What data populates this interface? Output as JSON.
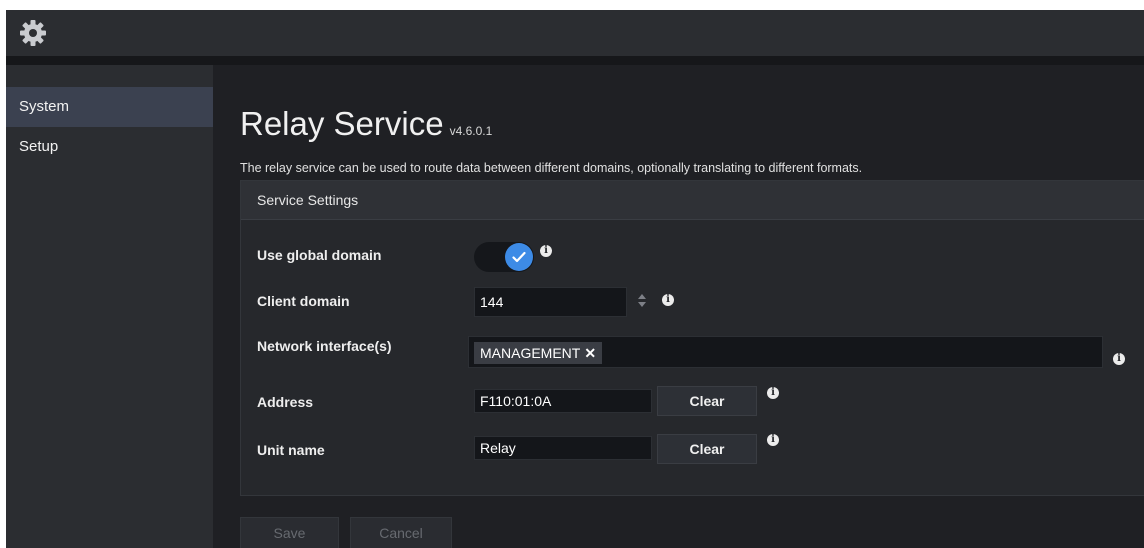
{
  "topbar": {
    "icon": "gear-icon"
  },
  "sidebar": {
    "items": [
      {
        "label": "System",
        "active": true
      },
      {
        "label": "Setup",
        "active": false
      }
    ]
  },
  "page": {
    "title": "Relay Service",
    "version": "v4.6.0.1",
    "description": "The relay service can be used to route data between different domains, optionally translating to different formats."
  },
  "panel": {
    "title": "Service Settings",
    "use_global_domain": {
      "label": "Use global domain",
      "checked": true,
      "info_icon": "info-icon"
    },
    "client_domain": {
      "label": "Client domain",
      "value": "144",
      "info_icon": "info-icon"
    },
    "network_interfaces": {
      "label": "Network interface(s)",
      "tags": [
        "MANAGEMENT"
      ],
      "remove_glyph": "✕",
      "info_icon": "info-icon"
    },
    "address": {
      "label": "Address",
      "value": "F110:01:0A",
      "clear_label": "Clear",
      "info_icon": "info-icon"
    },
    "unit_name": {
      "label": "Unit name",
      "value": "Relay",
      "clear_label": "Clear",
      "info_icon": "info-icon"
    }
  },
  "footer": {
    "save_label": "Save",
    "cancel_label": "Cancel"
  },
  "colors": {
    "accent": "#3d8be6",
    "background": "#1f2024",
    "sidebar": "#2b2d31",
    "active_item": "#3b4150"
  }
}
